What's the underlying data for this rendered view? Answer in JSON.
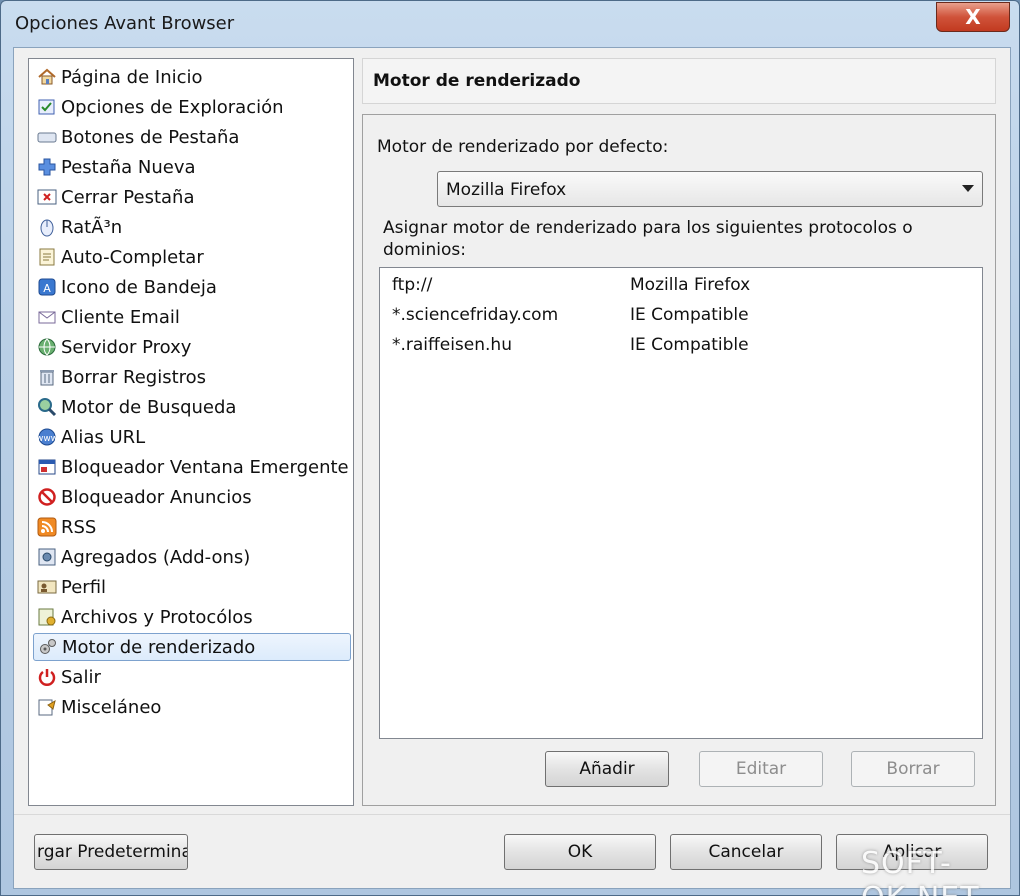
{
  "window": {
    "title": "Opciones Avant Browser",
    "close_label": "X"
  },
  "sidebar": {
    "items": [
      {
        "label": "Página de Inicio",
        "icon": "home-icon"
      },
      {
        "label": "Opciones de Exploración",
        "icon": "browse-options-icon"
      },
      {
        "label": "Botones de Pestaña",
        "icon": "tab-buttons-icon"
      },
      {
        "label": "Pestaña Nueva",
        "icon": "new-tab-icon"
      },
      {
        "label": "Cerrar Pestaña",
        "icon": "close-tab-icon"
      },
      {
        "label": "RatÃ³n",
        "icon": "mouse-icon"
      },
      {
        "label": "Auto-Completar",
        "icon": "autocomplete-icon"
      },
      {
        "label": "Icono de Bandeja",
        "icon": "tray-icon"
      },
      {
        "label": "Cliente Email",
        "icon": "email-icon"
      },
      {
        "label": "Servidor Proxy",
        "icon": "proxy-icon"
      },
      {
        "label": "Borrar Registros",
        "icon": "trash-icon"
      },
      {
        "label": "Motor de Busqueda",
        "icon": "search-engine-icon"
      },
      {
        "label": "Alias URL",
        "icon": "url-alias-icon"
      },
      {
        "label": "Bloqueador Ventana Emergente",
        "icon": "popup-blocker-icon"
      },
      {
        "label": "Bloqueador Anuncios",
        "icon": "ad-blocker-icon"
      },
      {
        "label": "RSS",
        "icon": "rss-icon"
      },
      {
        "label": "Agregados (Add-ons)",
        "icon": "addons-icon"
      },
      {
        "label": "Perfil",
        "icon": "profile-icon"
      },
      {
        "label": "Archivos y Protocólos",
        "icon": "files-protocols-icon"
      },
      {
        "label": "Motor de renderizado",
        "icon": "render-engine-icon",
        "selected": true
      },
      {
        "label": "Salir",
        "icon": "power-icon"
      },
      {
        "label": "Misceláneo",
        "icon": "misc-icon"
      }
    ]
  },
  "panel": {
    "title": "Motor de renderizado",
    "default_engine_label": "Motor de renderizado por defecto:",
    "default_engine_value": "Mozilla Firefox",
    "assign_label": "Asignar motor de renderizado para los siguientes protocolos o dominios:",
    "rows": [
      {
        "domain": "ftp://",
        "engine": "Mozilla Firefox"
      },
      {
        "domain": "*.sciencefriday.com",
        "engine": "IE Compatible"
      },
      {
        "domain": "*.raiffeisen.hu",
        "engine": "IE Compatible"
      }
    ],
    "add_label": "Añadir",
    "edit_label": "Editar",
    "delete_label": "Borrar"
  },
  "footer": {
    "defaults_label": "rgar Predetermina",
    "ok_label": "OK",
    "cancel_label": "Cancelar",
    "apply_label": "Aplicar"
  },
  "watermark": "SOFT-OK.NET",
  "colors": {
    "selection_border": "#7da2ce",
    "close_button": "#c23a20",
    "titlebar": "#c9dcef"
  }
}
